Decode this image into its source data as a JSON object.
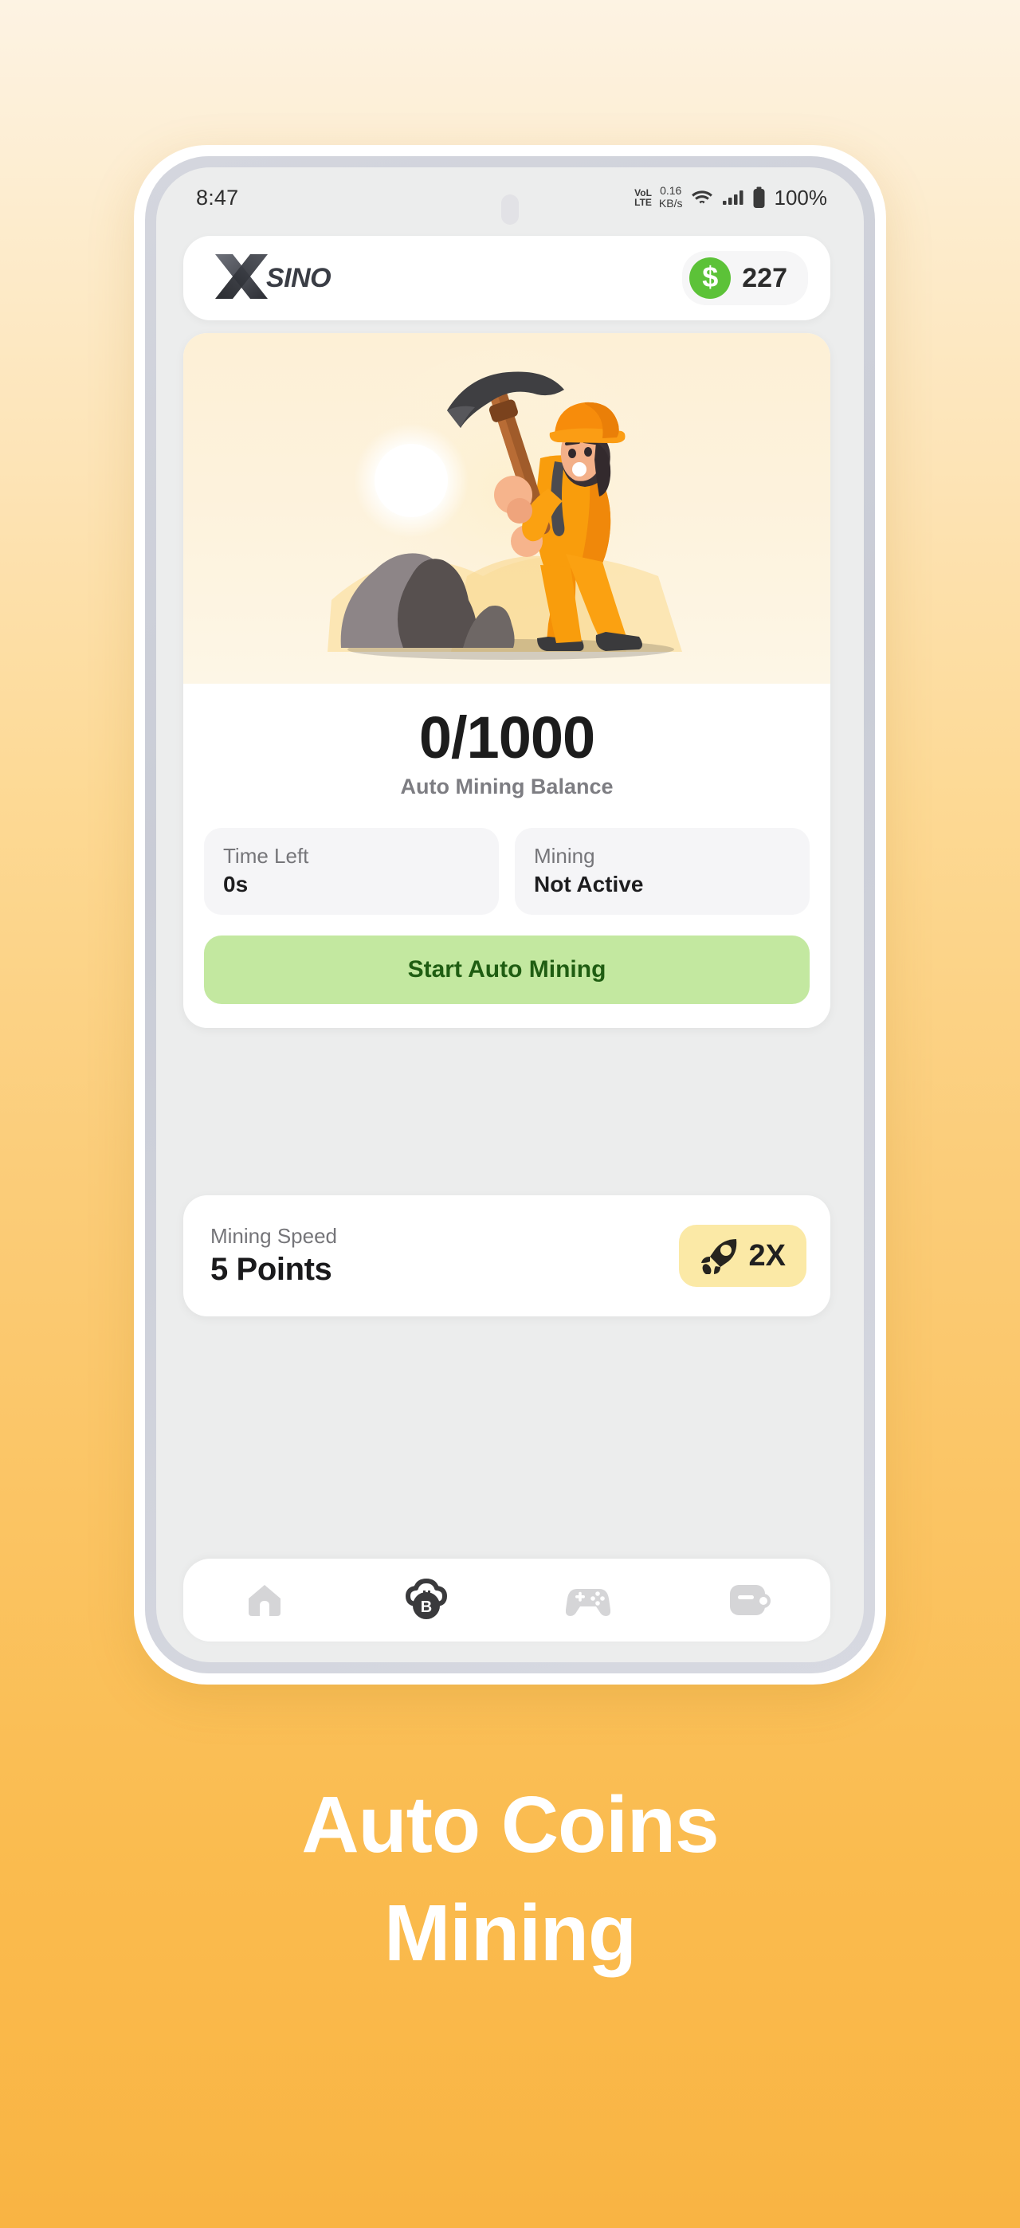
{
  "status_bar": {
    "time": "8:47",
    "network_label_top": "VoL",
    "network_label_bottom": "LTE",
    "data_rate_value": "0.16",
    "data_rate_unit": "KB/s",
    "battery_percent": "100%",
    "icons": [
      "wifi-icon",
      "cellular-signal-icon",
      "battery-icon"
    ]
  },
  "header": {
    "brand_mark": "X",
    "brand_name": "SINO",
    "coin_symbol": "$",
    "coin_balance": "227"
  },
  "mining_card": {
    "illustration_name": "miner-with-pickaxe-illustration",
    "balance_value": "0/1000",
    "balance_label": "Auto Mining Balance",
    "stats": [
      {
        "label": "Time Left",
        "value": "0s"
      },
      {
        "label": "Mining",
        "value": "Not Active"
      }
    ],
    "primary_action": "Start Auto Mining"
  },
  "speed_card": {
    "label": "Mining Speed",
    "value": "5 Points",
    "boost_label": "2X",
    "boost_icon": "rocket-icon"
  },
  "bottom_nav": {
    "items": [
      {
        "name": "home",
        "icon": "home-icon",
        "active": false
      },
      {
        "name": "cloud-mining",
        "icon": "cloud-bitcoin-icon",
        "active": true
      },
      {
        "name": "games",
        "icon": "gamepad-icon",
        "active": false
      },
      {
        "name": "wallet",
        "icon": "wallet-icon",
        "active": false
      }
    ]
  },
  "caption": {
    "line1": "Auto Coins",
    "line2": "Mining"
  },
  "colors": {
    "background_top": "#fdf3e3",
    "background_bottom": "#f9b443",
    "accent_green": "#5cc238",
    "button_green_bg": "#c3e8a0",
    "button_green_text": "#1f5d12",
    "boost_yellow": "#fbe9a6",
    "illustration_orange": "#f79009",
    "screen_bg": "#eceded"
  }
}
